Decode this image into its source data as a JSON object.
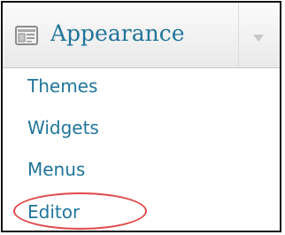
{
  "menu": {
    "title": "Appearance",
    "icon": "appearance-panel-icon",
    "toggle_icon": "chevron-down-icon",
    "accent_color": "#21759b",
    "items": [
      {
        "label": "Themes"
      },
      {
        "label": "Widgets"
      },
      {
        "label": "Menus"
      },
      {
        "label": "Editor"
      }
    ],
    "highlighted_item": "Editor",
    "highlight_color": "#e04848"
  }
}
